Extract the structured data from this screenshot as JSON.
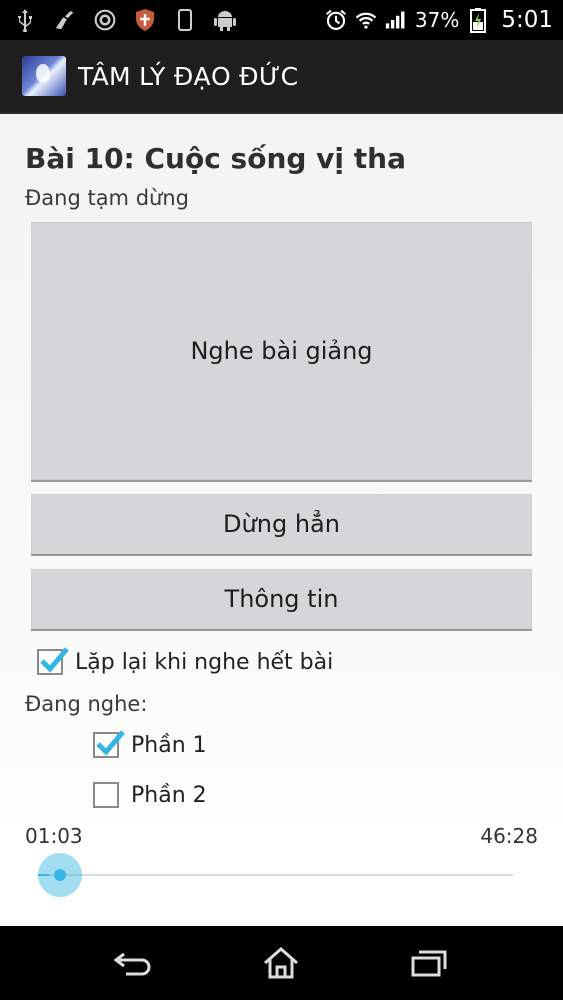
{
  "status_bar": {
    "battery_percent": "37%",
    "clock": "5:01",
    "icons": [
      "usb-icon",
      "cleaner-icon",
      "sync-icon",
      "shield-icon",
      "phone-icon",
      "android-icon",
      "alarm-icon",
      "wifi-icon",
      "signal-icon",
      "battery-charging-icon"
    ]
  },
  "action_bar": {
    "title": "TÂM LÝ ĐẠO ĐỨC"
  },
  "lesson": {
    "title": "Bài 10: Cuộc sống vị tha",
    "status": "Đang tạm dừng"
  },
  "buttons": {
    "listen": "Nghe bài giảng",
    "stop": "Dừng hẳn",
    "info": "Thông tin"
  },
  "repeat": {
    "label": "Lặp lại khi nghe hết bài",
    "checked": true
  },
  "parts": {
    "heading": "Đang nghe:",
    "items": [
      {
        "label": "Phần 1",
        "checked": true
      },
      {
        "label": "Phần 2",
        "checked": false
      }
    ]
  },
  "player": {
    "current_time": "01:03",
    "total_time": "46:28",
    "progress": 0.023
  },
  "colors": {
    "accent": "#33b5e5",
    "action_bar": "#1e1e1e",
    "button": "#d6d5d7"
  }
}
